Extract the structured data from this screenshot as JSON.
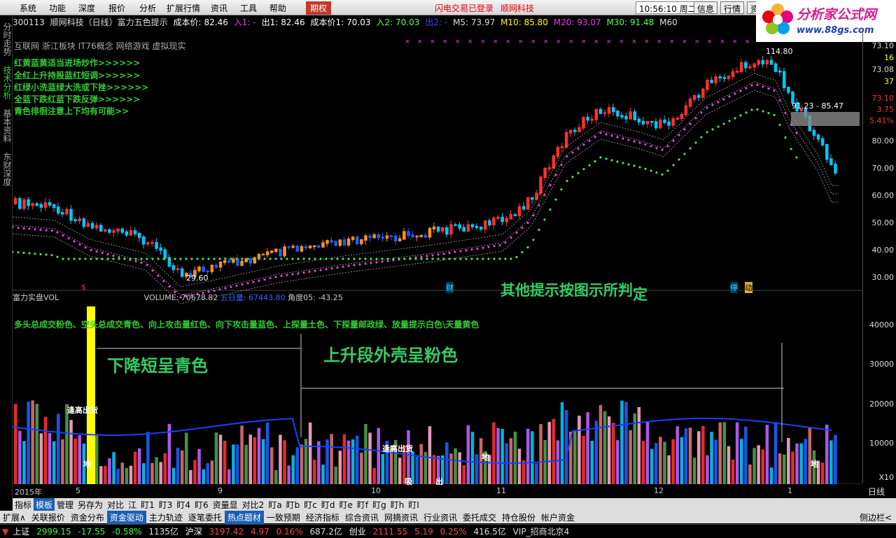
{
  "menubar": {
    "items": [
      "系统",
      "功能",
      "深度",
      "报价",
      "分析",
      "扩展行情",
      "资讯",
      "工具",
      "帮助"
    ],
    "highlight": "期权",
    "alert": "闪电交易已登录",
    "brokerage": "顺网科技",
    "time": "10:56:10",
    "weekday": "周二",
    "buttons": [
      "信息",
      "行情",
      "资"
    ]
  },
  "logo": {
    "title": "分析家公式网",
    "url": "www.88gs.com"
  },
  "left_tabs": [
    "分时走势",
    "技术分析",
    "基本资料",
    "东财深度"
  ],
  "infobar": {
    "code": "300113",
    "name": "顺网科技（日线）富力五色提示",
    "cost_label": "成本价:",
    "cost": "82.46",
    "in1_label": "入1:",
    "in1": "-",
    "out1_label": "出1:",
    "out1": "82.46",
    "cost1_label": "成本价1:",
    "cost1": "70.03",
    "in2_label": "入2:",
    "in2": "70.03",
    "out2_label": "出2:",
    "out2": "-",
    "m5": "M5: 73.97",
    "m10": "M10: 85.80",
    "m20": "M20: 93.07",
    "m30": "M30: 91.48",
    "m60": "M60"
  },
  "concepts": "互联网  浙江板块  IT76概念  网络游戏  虚拟现实",
  "signals": [
    "红黄蓝黄适当进场炒作>>>>>>",
    "全红上升持股蓝红短调>>>>>>",
    "红绿小洗蓝绿大洗或下挫>>>>>>",
    "全蓝下跌红蓝下跌反弹>>>>>>",
    "青色徘徊注意上下均有可能>>"
  ],
  "price_labels": {
    "high": "114.80",
    "low": "29.60",
    "box": "91.23 - 85.47",
    "yen": "¥"
  },
  "markers": {
    "s": "$",
    "cai": "财",
    "ting": "停",
    "dong": "动"
  },
  "notes": {
    "main": "其他提示按图示所判",
    "main_tail": "定",
    "down": "下降短呈青色",
    "up": "上升段外壳呈粉色"
  },
  "price_axis": [
    "73.10",
    "16",
    "73.08",
    "37",
    "73.10",
    "3.75",
    "5.41%",
    "80.00",
    "70.00",
    "60.00",
    "50.00",
    "40.00",
    "30.00"
  ],
  "volume": {
    "title": "富力实盘VOL",
    "volume_label": "VOLUME:",
    "volume_value": "70678.82",
    "ma5_label": "五日量:",
    "ma5_value": "67443.80",
    "angle_label": "角度05:",
    "angle_value": "-43.25",
    "legend": "多头总成交粉色、空头总成交青色、向上攻击量红色、向下攻击量蓝色、上探量土色、下探量邮政绿、放量提示白色\\天量黄色",
    "axis": [
      "40000",
      "30000",
      "20000",
      "10000",
      "X10"
    ],
    "labels": {
      "fenggao1": "逢高出货",
      "di1": "地",
      "fenggao2": "逢高出货",
      "xi": "吸",
      "chu": "出",
      "di2": "地",
      "di3": "地"
    }
  },
  "time_axis": {
    "labels": [
      "2015年",
      "5",
      "9",
      "10",
      "11",
      "12",
      "1"
    ],
    "period": "日线"
  },
  "tabrow": [
    "指标",
    "模板",
    "管理",
    "另存为",
    "对比",
    "江",
    "盯1",
    "盯3",
    "盯4",
    "盯6",
    "资量显",
    "对比2",
    "盯a",
    "盯b",
    "盯c",
    "盯d",
    "盯e",
    "盯f",
    "盯g",
    "盯h",
    "盯I"
  ],
  "bottomnav": [
    "扩展∧",
    "关联报价",
    "资金分布",
    "资金驱动",
    "主力轨迹",
    "逐笔委托",
    "热点题材",
    "一致预期",
    "经济指标",
    "综合资讯",
    "网摘资讯",
    "行业资讯",
    "委托成交",
    "持仓股份",
    "帐户资金"
  ],
  "bottom_right": "侧边栏<",
  "statusbar": {
    "sh_label": "上证",
    "sh_index": "2999.15",
    "sh_change": "-17.55",
    "sh_pct": "-0.58%",
    "sh_amount": "1135亿",
    "sz_label": "沪深",
    "sz_index": "3197.42",
    "sz_change": "4.97",
    "sz_pct": "0.16%",
    "sz_amount": "687.2亿",
    "cy_label": "创业",
    "cy_index": "2111.55",
    "cy_change": "5.19",
    "cy_pct": "0.25%",
    "cy_amount": "416.5亿",
    "server": "VIP_招商北京4"
  },
  "colors": {
    "up": "#ff3030",
    "down": "#00d8ff",
    "ma_pink": "#e040e0",
    "ma_green": "#50e050",
    "note": "#33cc66"
  }
}
